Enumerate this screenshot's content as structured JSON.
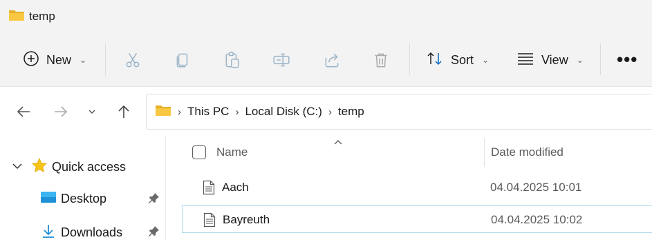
{
  "window": {
    "title": "temp"
  },
  "toolbar": {
    "new_label": "New",
    "sort_label": "Sort",
    "view_label": "View",
    "more_label": "•••"
  },
  "address": {
    "crumbs": [
      "This PC",
      "Local Disk (C:)",
      "temp"
    ]
  },
  "sidebar": {
    "items": [
      {
        "label": "Quick access",
        "icon": "star-icon"
      },
      {
        "label": "Desktop",
        "icon": "desktop-folder-icon",
        "pinned": true
      },
      {
        "label": "Downloads",
        "icon": "download-icon",
        "pinned": true
      }
    ]
  },
  "file_list": {
    "columns": [
      "Name",
      "Date modified"
    ],
    "rows": [
      {
        "name": "Aach",
        "date_modified": "04.04.2025 10:01",
        "selected": false
      },
      {
        "name": "Bayreuth",
        "date_modified": "04.04.2025 10:02",
        "selected": true
      }
    ]
  },
  "colors": {
    "accent": "#0067c0",
    "folder": "#f8c843",
    "selection_border": "#a8d8e8",
    "star": "#f5c518"
  }
}
